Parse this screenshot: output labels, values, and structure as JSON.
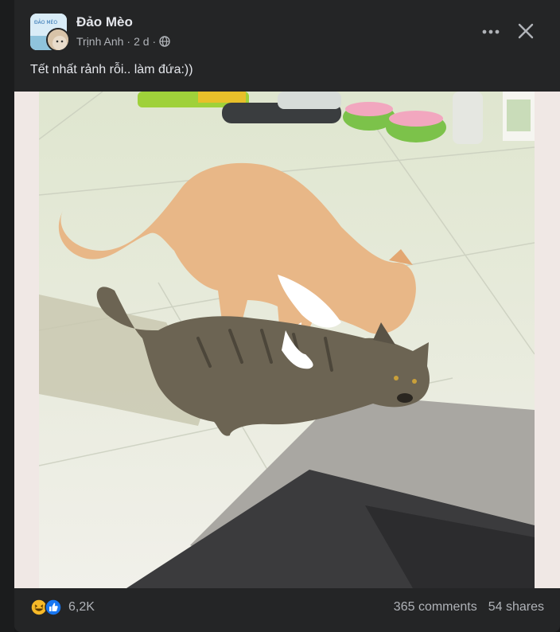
{
  "post": {
    "group_name": "Đảo Mèo",
    "author": "Trịnh Anh",
    "time": "2 d",
    "separator": "·",
    "privacy_icon": "globe-icon",
    "text": "Tết nhất rảnh rỗi.. làm đứa:))"
  },
  "header": {
    "more_icon": "more-options-icon",
    "close_icon": "close-icon"
  },
  "media": {
    "subject": "photo"
  },
  "footer": {
    "reaction_icons": [
      "haha-icon",
      "like-icon"
    ],
    "reaction_count": "6,2K",
    "comments": "365 comments",
    "shares": "54 shares"
  },
  "colors": {
    "background": "#18191a",
    "card": "#242526",
    "text_primary": "#e4e6eb",
    "text_secondary": "#b0b3b8",
    "like_blue": "#1877f2",
    "haha_yellow": "#f7b928"
  }
}
